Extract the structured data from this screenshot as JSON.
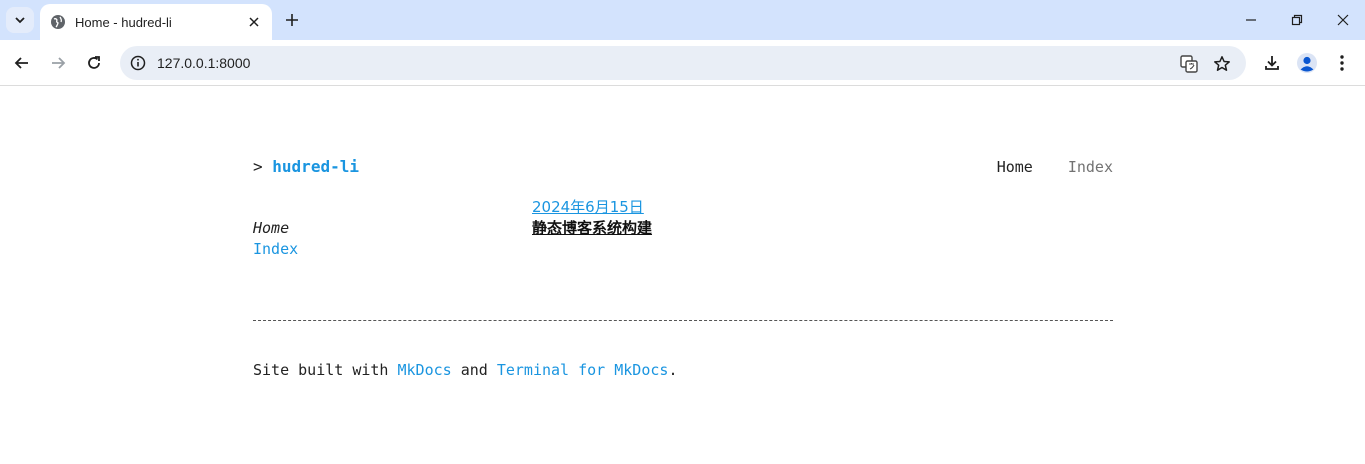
{
  "browser": {
    "tab_title": "Home - hudred-li",
    "url": "127.0.0.1:8000"
  },
  "site": {
    "caret": ">",
    "name": "hudred-li",
    "nav": [
      {
        "label": "Home"
      },
      {
        "label": "Index"
      }
    ],
    "sidebar": {
      "current": "Home",
      "link": "Index"
    },
    "post": {
      "date": "2024年6月15日",
      "title": "静态博客系统构建"
    },
    "footer": {
      "prefix": "Site built with ",
      "link1": "MkDocs",
      "middle": " and ",
      "link2": "Terminal for MkDocs",
      "suffix": "."
    }
  },
  "colors": {
    "tabbar": "#d3e3fd",
    "link": "#1a95e0",
    "text": "#222222"
  }
}
